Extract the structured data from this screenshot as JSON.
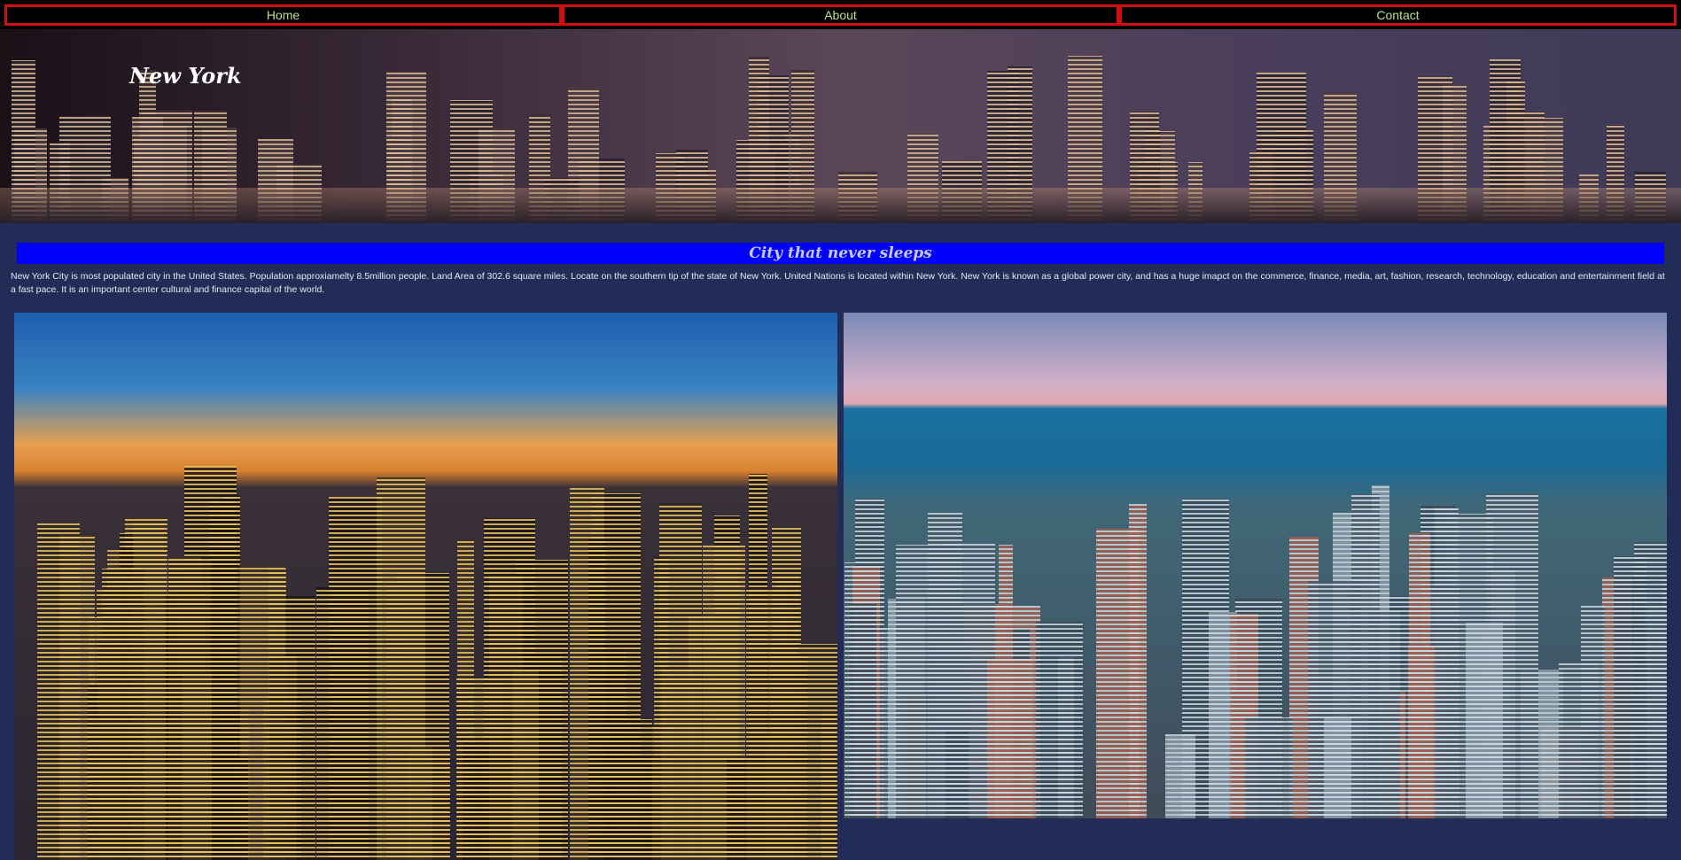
{
  "nav": {
    "items": [
      {
        "label": "Home"
      },
      {
        "label": "About"
      },
      {
        "label": "Contact"
      }
    ]
  },
  "banner": {
    "title": "New York"
  },
  "section": {
    "heading": "City that never sleeps",
    "paragraph": "New York City is most populated city in the United States. Population approxiamelty 8.5million people. Land Area of 302.6 square miles. Locate on the southern tip of the state of New York. United Nations is located within New York. New York is known as a global power city, and has a huge imapct on the commerce, finance, media, art, fashion, research, technology, education and entertainment field at a fast pace. It is an important center cultural and finance capital of the world."
  },
  "colors": {
    "background": "#222c56",
    "nav_border": "#d01010",
    "nav_text": "#b8e08a",
    "heading_bg": "#0000ff"
  }
}
